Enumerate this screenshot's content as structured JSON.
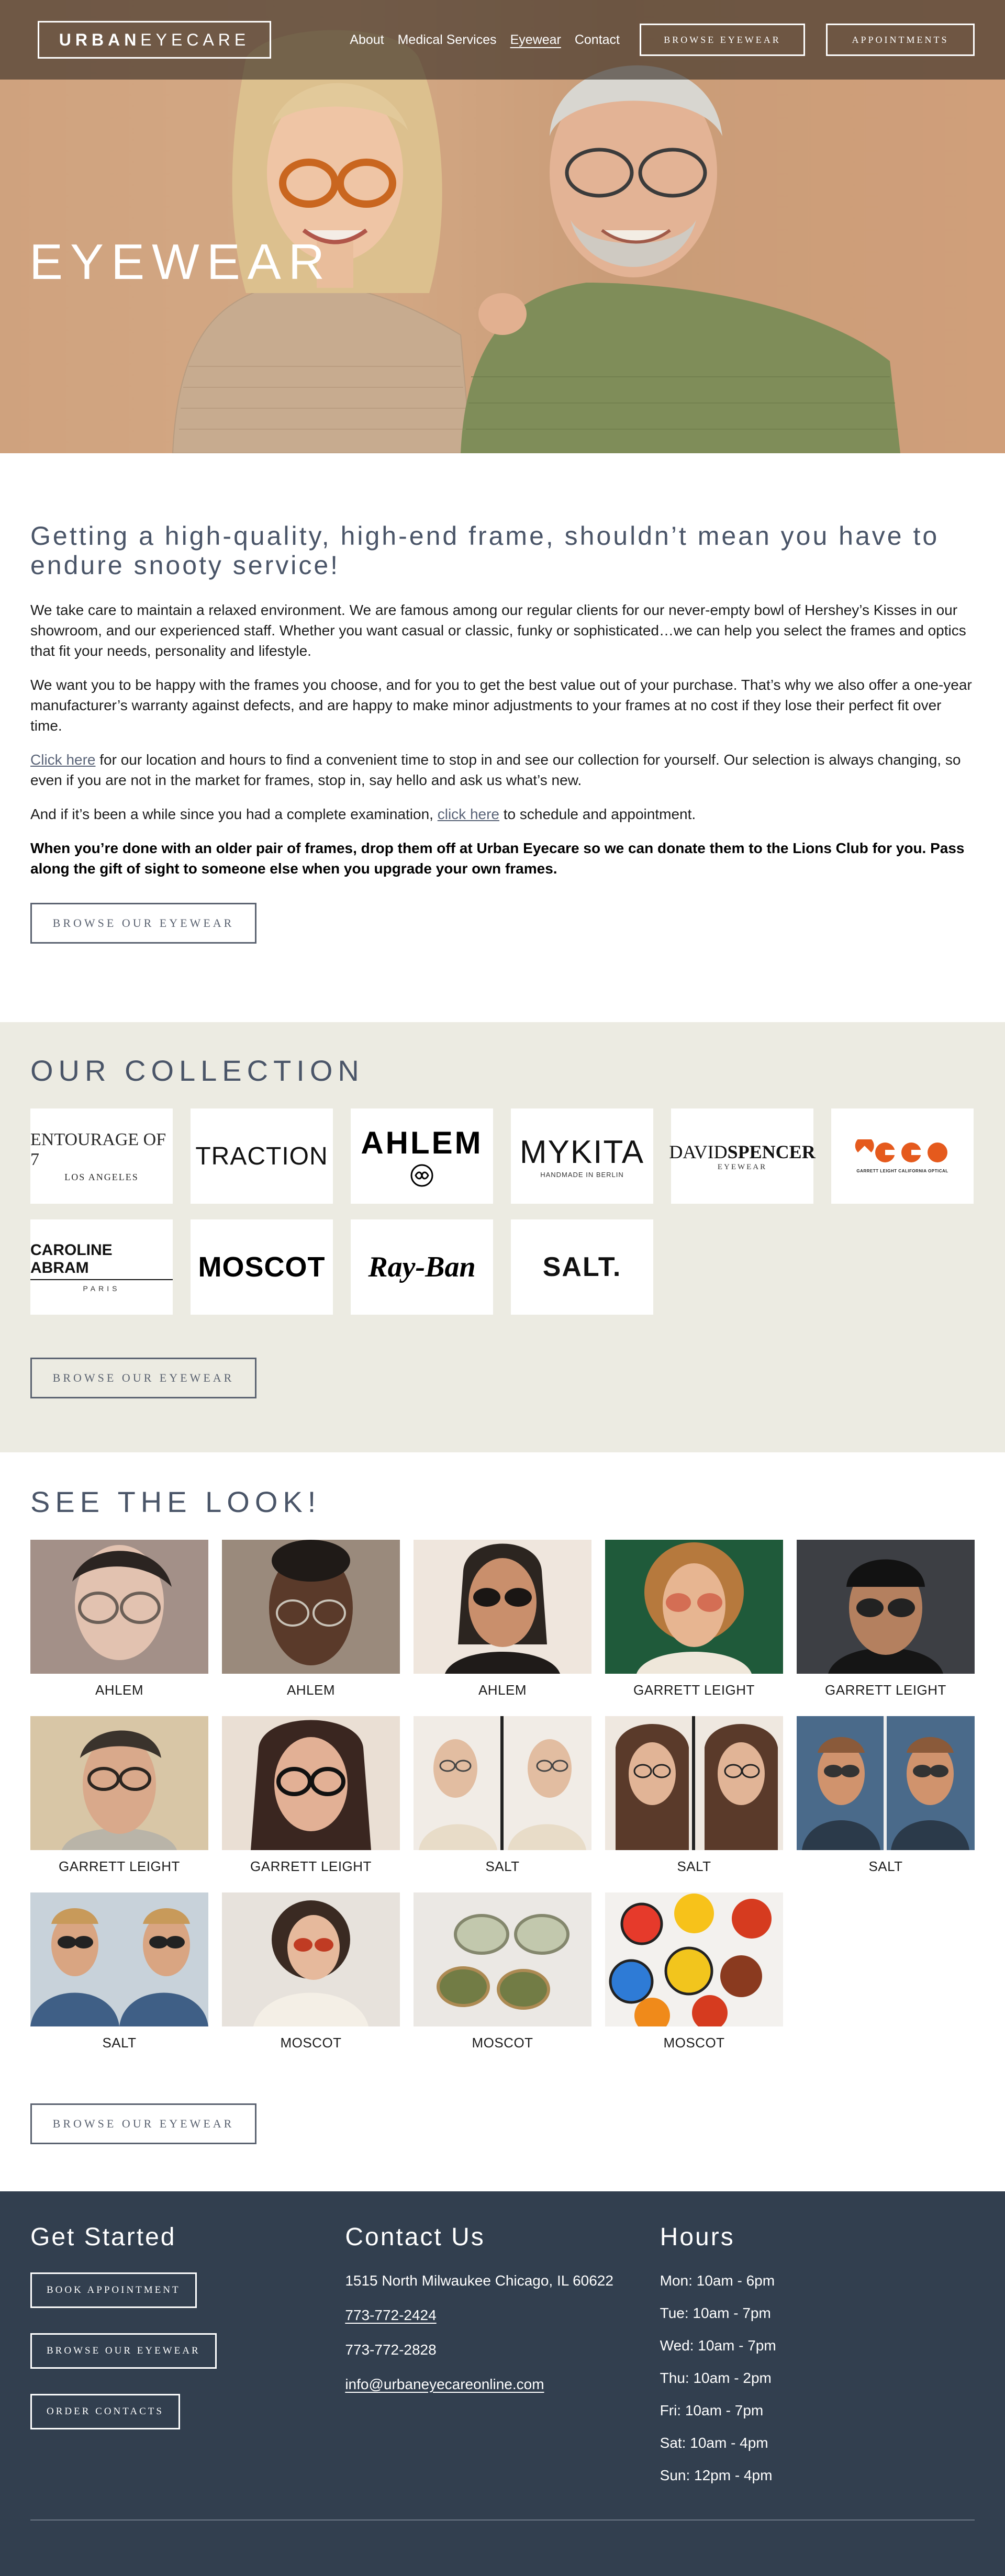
{
  "nav": {
    "logo_bold": "URBAN",
    "logo_light": "EYECARE",
    "links": [
      "About",
      "Medical Services",
      "Eyewear",
      "Contact"
    ],
    "active": "Eyewear",
    "btn_browse": "BROWSE EYEWEAR",
    "btn_appointments": "APPOINTMENTS"
  },
  "hero": {
    "title": "EYEWEAR"
  },
  "intro": {
    "heading": "Getting a high-quality, high-end frame, shouldn’t mean you have to endure snooty service!",
    "p1": "We take care to maintain a relaxed environment. We are famous among our regular clients for our never-empty bowl of Hershey’s Kisses in our showroom, and our experienced staff. Whether you want casual or classic, funky or sophisticated…we can help you select the frames and optics that fit your needs, personality and lifestyle.",
    "p2": "We want you to be happy with the frames you choose, and for you to get the best value out of your purchase. That’s why we also offer a one-year manufacturer’s warranty against defects, and are happy to make minor adjustments to your frames at no cost if they lose their perfect fit over time.",
    "p3_link": "Click here",
    "p3_rest": " for our location and hours to find a convenient time to stop in and see our collection for yourself. Our selection is always changing, so even if you are not in the market for frames, stop in, say hello and ask us what’s new.",
    "p4_start": "And if it’s been a while since you had a complete examination, ",
    "p4_link": "click here",
    "p4_end": " to schedule and appointment.",
    "p5": "When you’re done with an older pair of frames, drop them off at Urban Eyecare so we can donate them to the Lions Club for you. Pass along the gift of sight to someone else when you upgrade your own frames.",
    "button": "BROWSE OUR EYEWEAR"
  },
  "collection": {
    "title": "OUR COLLECTION",
    "brands": {
      "entourage": "ENTOURAGE OF 7",
      "entourage_sub": "LOS ANGELES",
      "traction": "TRACTION",
      "ahlem": "AHLEM",
      "mykita": "MYKITA",
      "mykita_sub": "HANDMADE IN BERLIN",
      "david_a": "DAVID",
      "david_b": "SPENCER",
      "david_sub": "EYEWEAR",
      "gl_sub": "GARRETT LEIGHT CALIFORNIA OPTICAL",
      "caroline": "CAROLINE ABRAM",
      "caroline_sub": "PARIS",
      "moscot": "MOSCOT",
      "rayban": "Ray-Ban",
      "salt": "SALT."
    },
    "button": "BROWSE OUR EYEWEAR"
  },
  "looks": {
    "title": "SEE THE LOOK!",
    "items": [
      "AHLEM",
      "AHLEM",
      "AHLEM",
      "GARRETT LEIGHT",
      "GARRETT LEIGHT",
      "GARRETT LEIGHT",
      "GARRETT LEIGHT",
      "SALT",
      "SALT",
      "SALT",
      "SALT",
      "MOSCOT",
      "MOSCOT",
      "MOSCOT"
    ],
    "button": "BROWSE OUR EYEWEAR"
  },
  "footer": {
    "get_started": {
      "title": "Get Started",
      "buttons": [
        "BOOK APPOINTMENT",
        "BROWSE OUR EYEWEAR",
        "ORDER CONTACTS"
      ]
    },
    "contact": {
      "title": "Contact Us",
      "address": "1515 North Milwaukee Chicago, IL 60622",
      "phone1": "773-772-2424",
      "phone2": "773-772-2828",
      "email": "info@urbaneyecareonline.com"
    },
    "hours": {
      "title": "Hours",
      "lines": [
        "Mon: 10am - 6pm",
        "Tue: 10am - 7pm",
        "Wed: 10am - 7pm",
        "Thu: 10am - 2pm",
        "Fri: 10am - 7pm",
        "Sat: 10am - 4pm",
        "Sun: 12pm - 4pm"
      ]
    }
  }
}
